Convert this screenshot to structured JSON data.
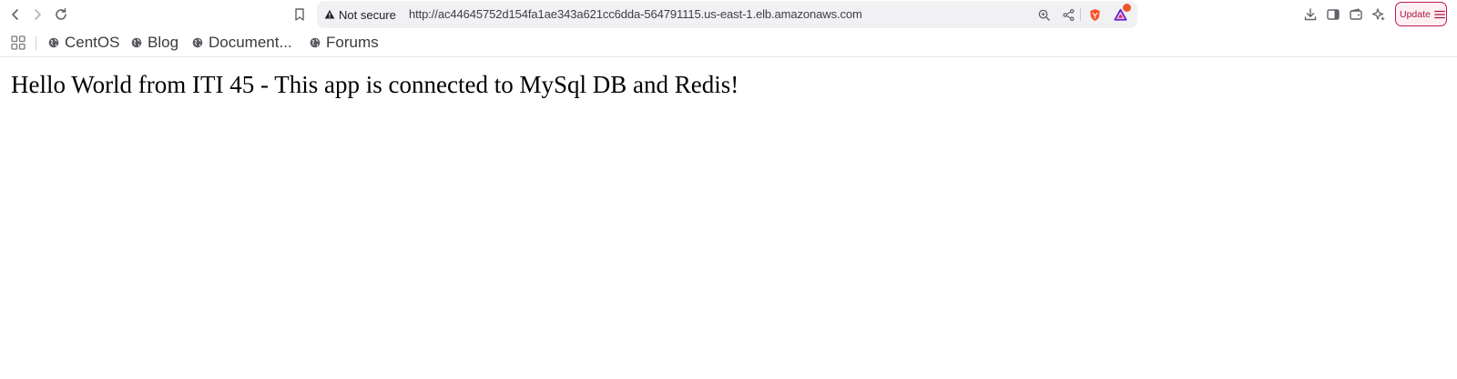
{
  "toolbar": {
    "security_label": "Not secure",
    "url": "http://ac44645752d154fa1ae343a621cc6dda-564791115.us-east-1.elb.amazonaws.com",
    "update_label": "Update",
    "icons": [
      "back-icon",
      "forward-icon",
      "reload-icon",
      "bookmark-icon",
      "zoom-icon",
      "share-icon",
      "brave-shields-icon",
      "brave-rewards-icon",
      "download-icon",
      "sidebar-icon",
      "wallet-icon",
      "leo-ai-icon",
      "menu-icon"
    ]
  },
  "bookmarks": {
    "items": [
      {
        "label": "CentOS"
      },
      {
        "label": "Blog"
      },
      {
        "label": "Document..."
      },
      {
        "label": "Forums"
      }
    ]
  },
  "page": {
    "message": "Hello World from ITI 45 - This app is connected to MySql DB and Redis!"
  },
  "colors": {
    "urlbar_bg": "#f1f1f4",
    "update_accent": "#c2185b",
    "brave_orange": "#fb542b",
    "rewards_purple": "#6a1fd1"
  }
}
